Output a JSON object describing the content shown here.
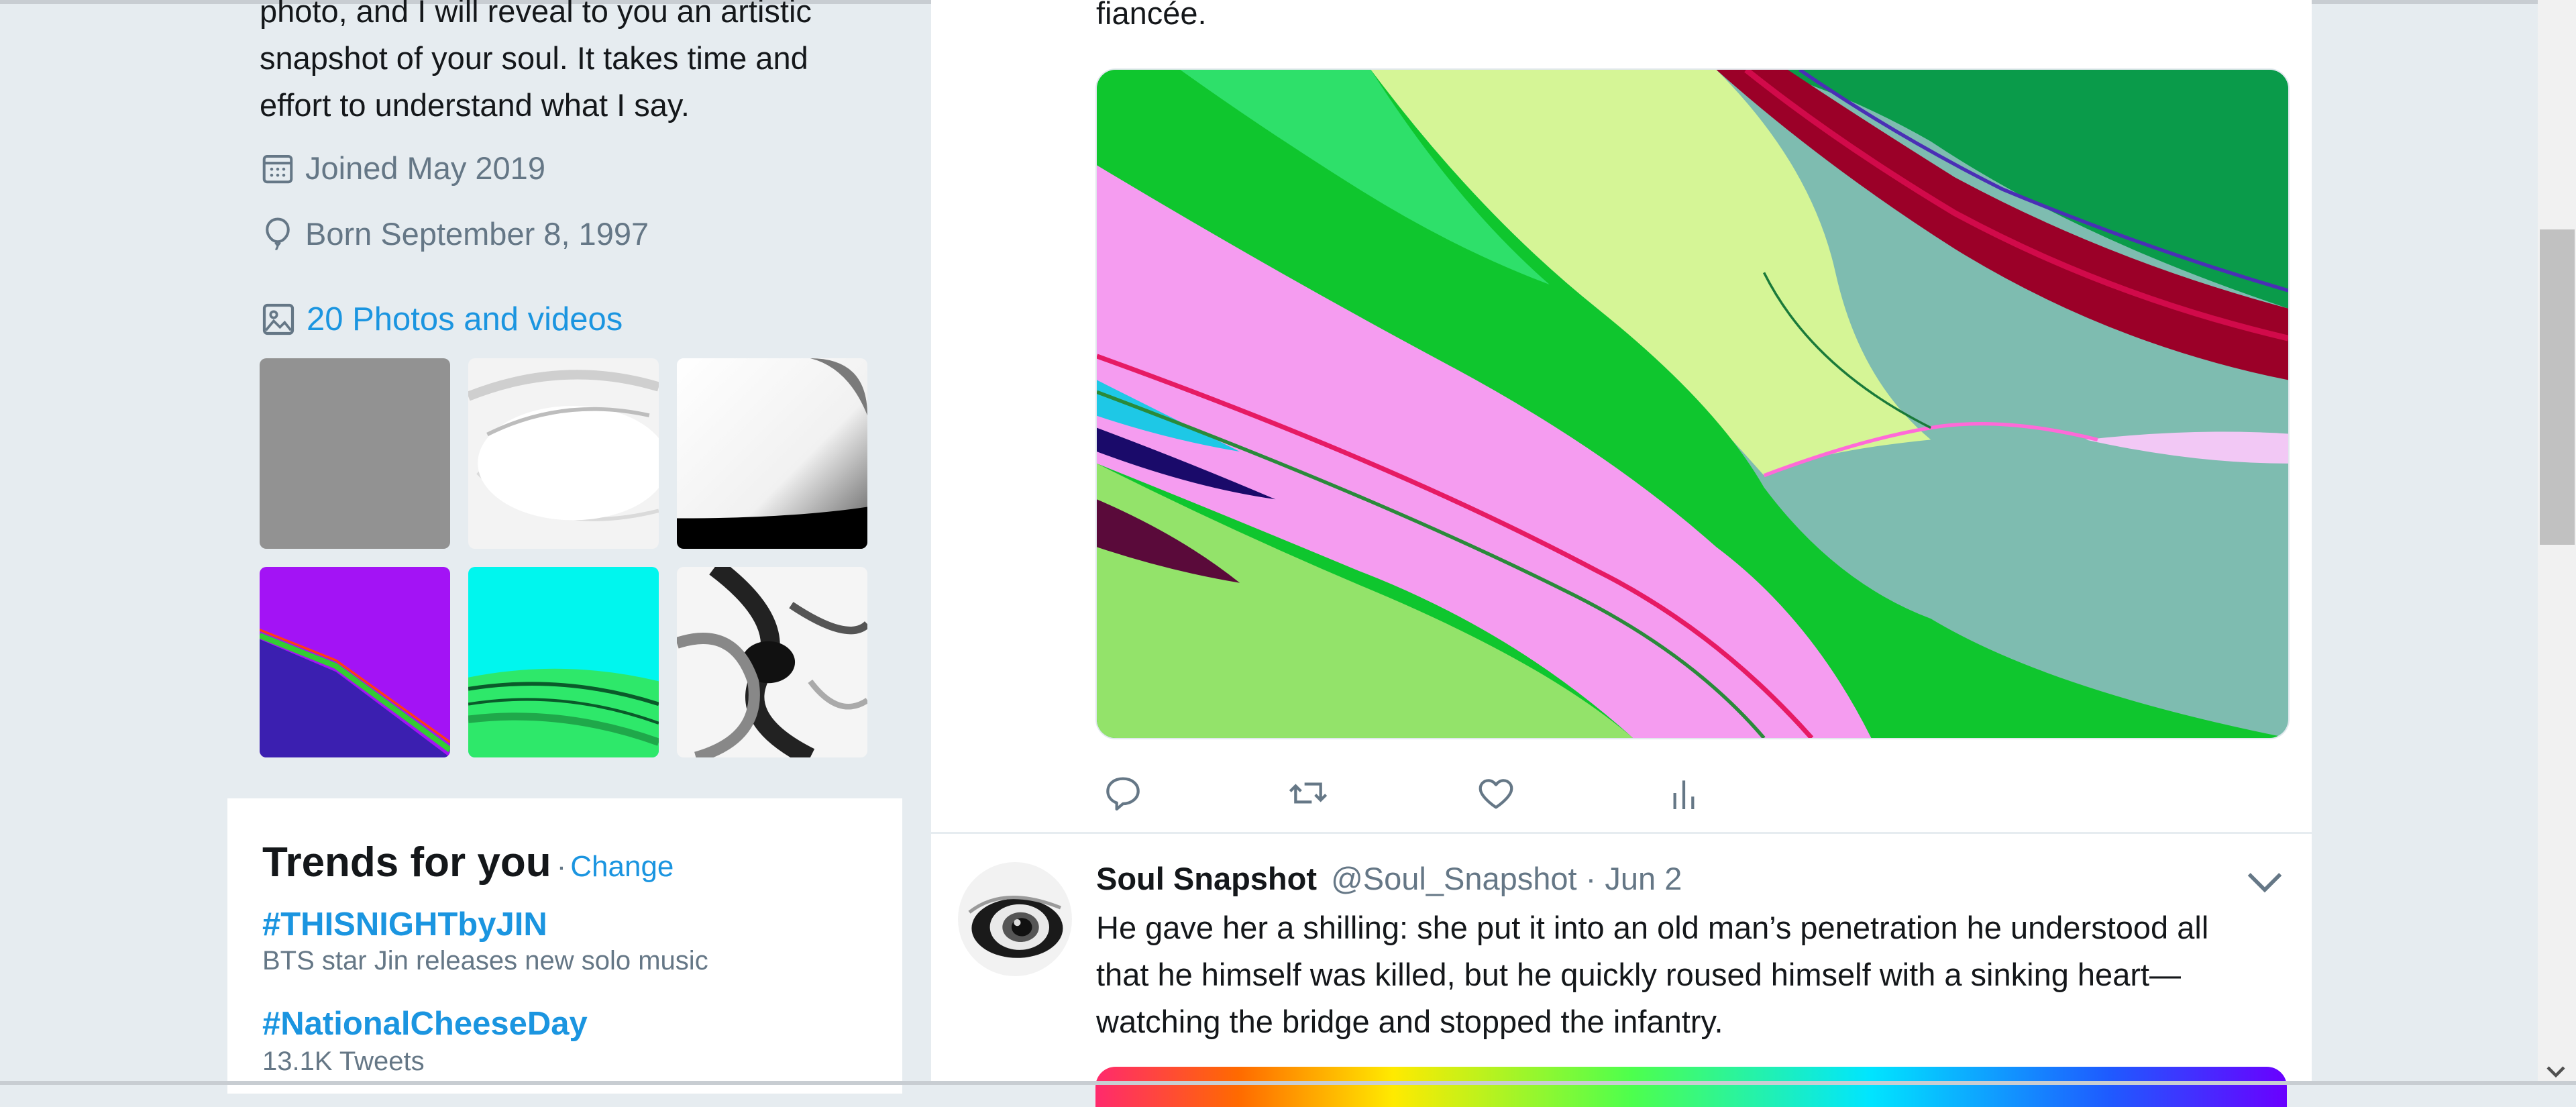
{
  "profile": {
    "bio_lines": [
      "photo, and I will reveal to you an artistic",
      "snapshot of your soul. It takes time and",
      "effort to understand what I say."
    ],
    "joined": "Joined May 2019",
    "born": "Born September 8, 1997",
    "photos_link": "20 Photos and videos",
    "calendar_icon": "calendar-icon",
    "balloon_icon": "balloon-icon",
    "image_icon": "image-icon"
  },
  "trends": {
    "title": "Trends for you",
    "separator": "·",
    "change_label": "Change",
    "items": [
      {
        "tag": "#THISNIGHTbyJIN",
        "sub": "BTS star Jin releases new solo music"
      },
      {
        "tag": "#NationalCheeseDay",
        "sub": "13.1K Tweets"
      }
    ]
  },
  "timeline": {
    "prev_tweet_tail": "fiancée.",
    "actions": [
      "reply-icon",
      "retweet-icon",
      "like-icon",
      "analytics-icon"
    ],
    "tweet": {
      "name": "Soul Snapshot",
      "handle": "@Soul_Snapshot",
      "separator": "·",
      "date": "Jun 2",
      "text_lines": [
        "He gave her a shilling: she put it into an old man’s penetration he understood all",
        "that he himself was killed, but he quickly roused himself with a sinking heart—",
        "watching the bridge and stopped the infantry."
      ]
    }
  },
  "colors": {
    "link": "#1b95e0",
    "muted": "#657786",
    "text": "#14171a",
    "background": "#e6ecf0"
  }
}
